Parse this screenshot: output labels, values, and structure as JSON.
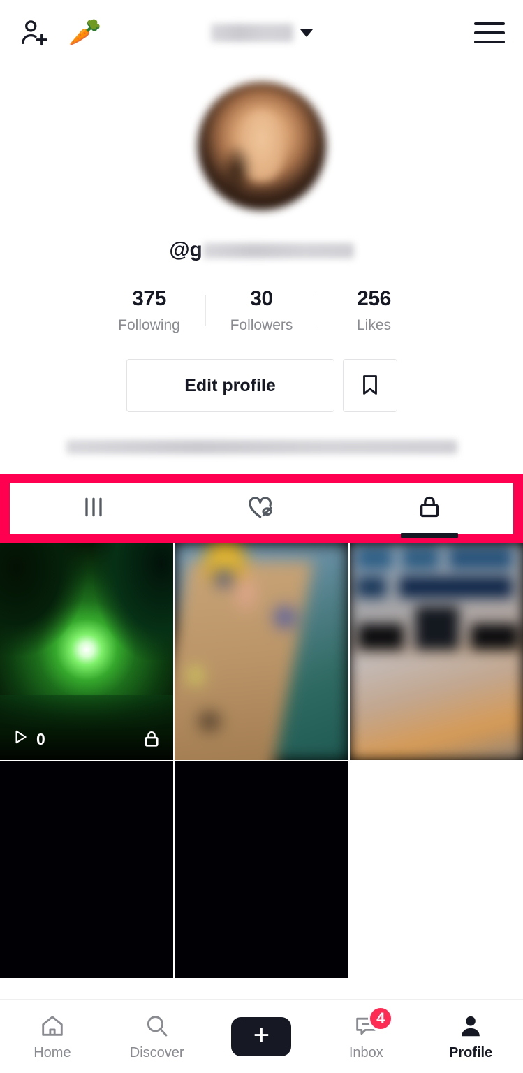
{
  "header": {
    "add_friends_icon": "add-person-icon",
    "promo_icon": "sparkle-carrot-emoji",
    "promo_glyph": "🥕",
    "account_name_redacted": true,
    "dropdown_caret_icon": "chevron-down-icon",
    "menu_icon": "hamburger-menu-icon"
  },
  "profile": {
    "avatar_alt": "profile-avatar-blurred",
    "handle_prefix": "@g",
    "handle_redacted": true,
    "bio_redacted": true,
    "stats": [
      {
        "value": "375",
        "label": "Following"
      },
      {
        "value": "30",
        "label": "Followers"
      },
      {
        "value": "256",
        "label": "Likes"
      }
    ],
    "edit_profile_label": "Edit profile",
    "bookmark_icon": "bookmark-icon"
  },
  "tabs": {
    "highlight_color": "#ff0050",
    "items": [
      {
        "name": "posts-tab",
        "icon": "grid-icon",
        "active": false
      },
      {
        "name": "liked-hidden-tab",
        "icon": "heart-slash-icon",
        "active": false
      },
      {
        "name": "private-tab",
        "icon": "lock-icon",
        "active": true
      }
    ]
  },
  "grid": {
    "cells": [
      {
        "kind": "green-night-video",
        "play_icon": "play-icon",
        "play_count": "0",
        "lock_icon": "lock-icon",
        "has_overlay": true
      },
      {
        "kind": "dock-water-blurred",
        "has_overlay": false
      },
      {
        "kind": "screenshot-blurred",
        "has_overlay": false
      },
      {
        "kind": "black",
        "has_overlay": false
      },
      {
        "kind": "black",
        "has_overlay": false
      },
      {
        "kind": "empty",
        "has_overlay": false
      }
    ]
  },
  "bottom_nav": {
    "items": [
      {
        "name": "nav-home",
        "label": "Home",
        "icon": "home-icon",
        "active": false
      },
      {
        "name": "nav-discover",
        "label": "Discover",
        "icon": "search-icon",
        "active": false
      },
      {
        "name": "nav-create",
        "label": "",
        "icon": "plus-icon",
        "active": false
      },
      {
        "name": "nav-inbox",
        "label": "Inbox",
        "icon": "message-icon",
        "active": false,
        "badge": "4"
      },
      {
        "name": "nav-profile",
        "label": "Profile",
        "icon": "person-icon",
        "active": true
      }
    ],
    "create_plus": "+"
  }
}
